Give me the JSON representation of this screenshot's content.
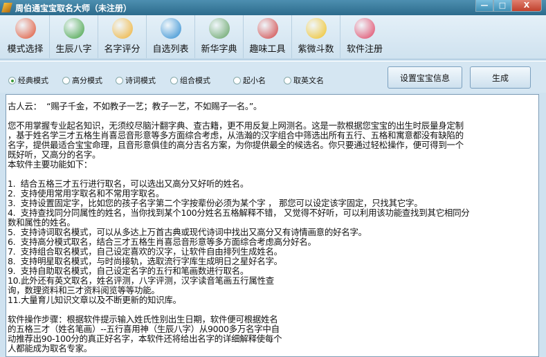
{
  "window": {
    "title": "周伯通宝宝取名大师（未注册）",
    "minimize": "—",
    "maximize": "□",
    "close": "X"
  },
  "toolbar": [
    {
      "label": "模式选择",
      "icon": "house-icon",
      "color": "#e05030"
    },
    {
      "label": "生辰八字",
      "icon": "globe-person-icon",
      "color": "#40a040"
    },
    {
      "label": "名字评分",
      "icon": "magnifier-icon",
      "color": "#f0b030"
    },
    {
      "label": "自选列表",
      "icon": "pyramid-globe-icon",
      "color": "#2a8ad0"
    },
    {
      "label": "新华字典",
      "icon": "book-person-icon",
      "color": "#60a060"
    },
    {
      "label": "趣味工具",
      "icon": "tools-icon",
      "color": "#d04040"
    },
    {
      "label": "紫微斗数",
      "icon": "star-icon",
      "color": "#f0c020"
    },
    {
      "label": "软件注册",
      "icon": "flower-icon",
      "color": "#e04060"
    }
  ],
  "modes": [
    {
      "label": "经典模式",
      "selected": true
    },
    {
      "label": "高分模式",
      "selected": false
    },
    {
      "label": "诗词模式",
      "selected": false
    },
    {
      "label": "组合模式",
      "selected": false
    },
    {
      "label": "起小名",
      "selected": false
    },
    {
      "label": "取英文名",
      "selected": false
    }
  ],
  "buttons": {
    "set_info": "设置宝宝信息",
    "generate": "生成"
  },
  "content_lines": [
    "古人云：  “赐子千金，不如教子一艺；教子一艺，不如赐子一名。”。",
    "",
    "您不用掌握专业起名知识，无须绞尽脑汁翻字典、查古籍，更不用反复上网测名。这是一款根据您宝宝的出生时辰量身定制",
    "，基于姓名学三才五格生肖喜忌音形意等多方面综合考虑，从浩瀚的汉字组合中筛选出所有五行、五格和寓意都没有缺陷的",
    "名字，提供最适合宝宝命理，且音形意俱佳的高分吉名方案，为你提供最全的候选名。你只要通过轻松操作，便可得到一个",
    "既好听，又高分的名字。",
    "本软件主要功能如下：",
    "",
    "1.  结合五格三才五行进行取名，可以选出又高分又好听的姓名。",
    "2.  支持使用常用字取名和不常用字取名。",
    "3.  支持设置固定字，比如您的孩子名字第二个字按辈份必须为某个字 ， 那您可以设定该字固定，只找其它字。",
    "4.  支持查找同分同属性的姓名，当你找到某个100分姓名五格解释不错， 又觉得不好听，可以利用该功能查找到其它相同分",
    "数和属性的姓名。",
    "5.  支持诗词取名模式，可以从多达上万首古典或现代诗词中找出又高分又有诗情画意的好名字。",
    "6.  支持高分模式取名，结合三才五格生肖喜忌音形意等多方面综合考虑高分好名。",
    "7.  支持组合取名模式，自己设定喜欢的汉字，让软件自由排列生成姓名。",
    "8.  支持明星取名模式，与时尚接轨，选取流行字库生成明日之星好名字。",
    "9.  支持自助取名模式，自己设定名字的五行和笔画数进行取名。",
    "10.此外还有英文取名，姓名评测，八字评测，汉字读音笔画五行属性查",
    "询，数理资料和三才资料阅览等等功能。",
    "11.大量育儿知识文章以及不断更新的知识库。",
    "",
    "软件操作步骤：根据软件提示输入姓氏性别出生日期，软件便可根据姓名",
    "的五格三才（姓名笔画）--五行喜用神（生辰八字）从9000多万名字中自",
    "动推荐出90-100分的真正好名字，本软件还将给出名字的详细解释使每个",
    "人都能成为取名专家。"
  ]
}
